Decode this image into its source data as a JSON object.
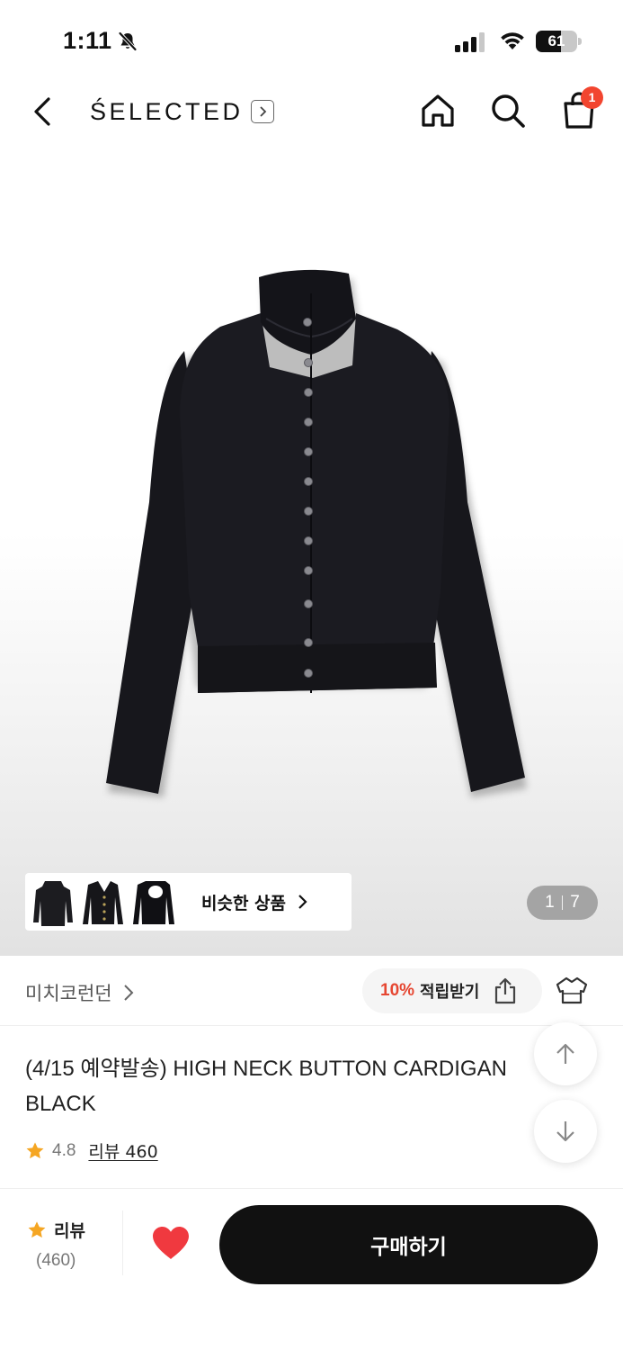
{
  "status_bar": {
    "time": "1:11",
    "battery": "61",
    "battery_level": 0.61
  },
  "header": {
    "brand": "ŚELECTED"
  },
  "cart": {
    "badge_count": "1"
  },
  "gallery": {
    "similar_label": "비슷한 상품",
    "pager_current": "1",
    "pager_total": "7"
  },
  "seller": {
    "name": "미치코런던"
  },
  "points": {
    "percent": "10%",
    "label": "적립받기"
  },
  "product": {
    "title": "(4/15 예약발송) HIGH NECK BUTTON CARDIGAN BLACK",
    "rating": "4.8",
    "review_link": "리뷰 460"
  },
  "bottom_bar": {
    "review_label": "리뷰",
    "review_count": "(460)",
    "buy_label": "구매하기"
  },
  "colors": {
    "accent": "#f2452f",
    "star": "#f5a623",
    "heart": "#f0393f",
    "buy_bg": "#111111"
  }
}
